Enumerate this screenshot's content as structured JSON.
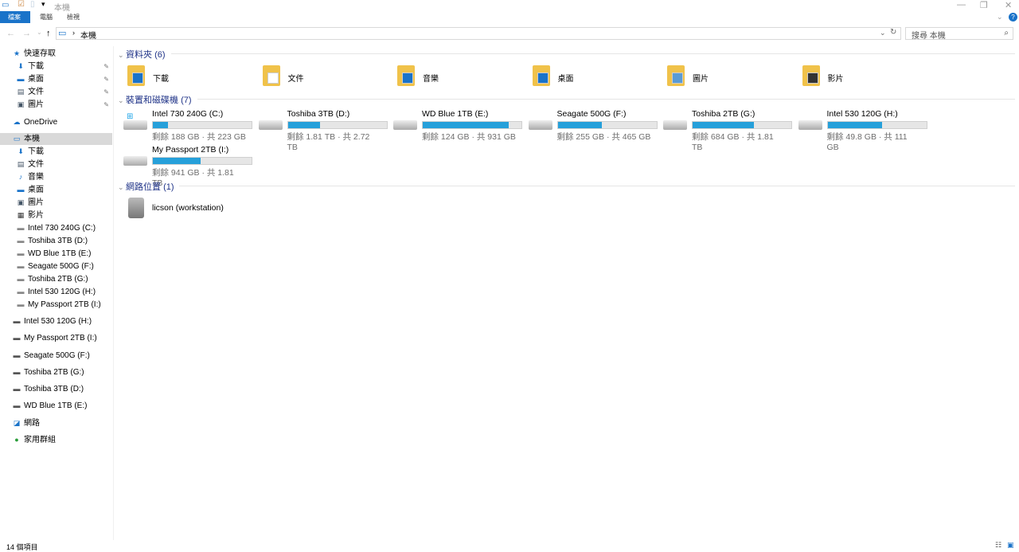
{
  "window": {
    "title": "本機",
    "controls": [
      "—",
      "❐",
      "✕"
    ]
  },
  "ribbon": {
    "tabs": [
      "檔案",
      "電腦",
      "檢視"
    ]
  },
  "address": {
    "path": "本機",
    "search_placeholder": "搜尋 本機"
  },
  "sidebar": [
    {
      "label": "快速存取",
      "icon": "star-icon",
      "g": "★",
      "c": "#1a73c9",
      "sel": false
    },
    {
      "label": "下載",
      "icon": "download-icon",
      "g": "⬇",
      "c": "#1a73c9",
      "indent": 1,
      "pin": true
    },
    {
      "label": "桌面",
      "icon": "desktop-icon",
      "g": "▬",
      "c": "#1a73c9",
      "indent": 1,
      "pin": true
    },
    {
      "label": "文件",
      "icon": "document-icon",
      "g": "▤",
      "c": "#456",
      "indent": 1,
      "pin": true
    },
    {
      "label": "圖片",
      "icon": "pictures-icon",
      "g": "▣",
      "c": "#456",
      "indent": 1,
      "pin": true
    },
    {
      "label": "OneDrive",
      "icon": "cloud-icon",
      "g": "☁",
      "c": "#1a73c9"
    },
    {
      "label": "本機",
      "icon": "computer-icon",
      "g": "▭",
      "c": "#1a73c9",
      "sel": true
    },
    {
      "label": "下載",
      "icon": "download-icon",
      "g": "⬇",
      "c": "#1a73c9",
      "indent": 1
    },
    {
      "label": "文件",
      "icon": "document-icon",
      "g": "▤",
      "c": "#456",
      "indent": 1
    },
    {
      "label": "音樂",
      "icon": "music-icon",
      "g": "♪",
      "c": "#1a73c9",
      "indent": 1
    },
    {
      "label": "桌面",
      "icon": "desktop-icon",
      "g": "▬",
      "c": "#1a73c9",
      "indent": 1
    },
    {
      "label": "圖片",
      "icon": "pictures-icon",
      "g": "▣",
      "c": "#456",
      "indent": 1
    },
    {
      "label": "影片",
      "icon": "video-icon",
      "g": "▦",
      "c": "#333",
      "indent": 1
    },
    {
      "label": "Intel 730 240G (C:)",
      "icon": "drive-icon",
      "g": "▬",
      "c": "#888",
      "indent": 1
    },
    {
      "label": "Toshiba 3TB (D:)",
      "icon": "drive-icon",
      "g": "▬",
      "c": "#888",
      "indent": 1
    },
    {
      "label": "WD Blue 1TB (E:)",
      "icon": "drive-icon",
      "g": "▬",
      "c": "#888",
      "indent": 1
    },
    {
      "label": "Seagate 500G (F:)",
      "icon": "drive-icon",
      "g": "▬",
      "c": "#888",
      "indent": 1
    },
    {
      "label": "Toshiba 2TB (G:)",
      "icon": "drive-icon",
      "g": "▬",
      "c": "#888",
      "indent": 1
    },
    {
      "label": "Intel 530 120G (H:)",
      "icon": "drive-icon",
      "g": "▬",
      "c": "#888",
      "indent": 1
    },
    {
      "label": "My Passport 2TB (I:)",
      "icon": "drive-icon",
      "g": "▬",
      "c": "#888",
      "indent": 1
    },
    {
      "label": "Intel 530 120G (H:)",
      "icon": "drive-icon",
      "g": "▬",
      "c": "#555",
      "gap": true
    },
    {
      "label": "My Passport 2TB (I:)",
      "icon": "drive-icon",
      "g": "▬",
      "c": "#555",
      "gap": true
    },
    {
      "label": "Seagate 500G (F:)",
      "icon": "drive-icon",
      "g": "▬",
      "c": "#555",
      "gap": true
    },
    {
      "label": "Toshiba 2TB (G:)",
      "icon": "drive-icon",
      "g": "▬",
      "c": "#555",
      "gap": true
    },
    {
      "label": "Toshiba 3TB (D:)",
      "icon": "drive-icon",
      "g": "▬",
      "c": "#555",
      "gap": true
    },
    {
      "label": "WD Blue 1TB (E:)",
      "icon": "drive-icon",
      "g": "▬",
      "c": "#555",
      "gap": true
    },
    {
      "label": "網路",
      "icon": "network-icon",
      "g": "◪",
      "c": "#1a73c9",
      "gap": true
    },
    {
      "label": "家用群組",
      "icon": "homegroup-icon",
      "g": "●",
      "c": "#2a9d3a",
      "gap": true
    }
  ],
  "groups": {
    "folders": "資料夾 (6)",
    "drives": "裝置和磁碟機 (7)",
    "network": "網路位置 (1)"
  },
  "folders": [
    "下載",
    "文件",
    "音樂",
    "桌面",
    "圖片",
    "影片"
  ],
  "drives": [
    {
      "name": "Intel 730 240G (C:)",
      "free": "剩餘 188 GB · 共 223 GB",
      "used_pct": 15.7
    },
    {
      "name": "Toshiba 3TB (D:)",
      "free": "剩餘 1.81 TB · 共 2.72 TB",
      "used_pct": 33
    },
    {
      "name": "WD Blue 1TB (E:)",
      "free": "剩餘 124 GB · 共 931 GB",
      "used_pct": 87
    },
    {
      "name": "Seagate 500G (F:)",
      "free": "剩餘 255 GB · 共 465 GB",
      "used_pct": 45
    },
    {
      "name": "Toshiba 2TB (G:)",
      "free": "剩餘 684 GB · 共 1.81 TB",
      "used_pct": 62
    },
    {
      "name": "Intel 530 120G (H:)",
      "free": "剩餘 49.8 GB · 共 111 GB",
      "used_pct": 55
    },
    {
      "name": "My Passport 2TB (I:)",
      "free": "剩餘 941 GB · 共 1.81 TB",
      "used_pct": 48
    }
  ],
  "network": [
    {
      "name": "licson (workstation)"
    }
  ],
  "status": {
    "count": "14 個項目"
  }
}
